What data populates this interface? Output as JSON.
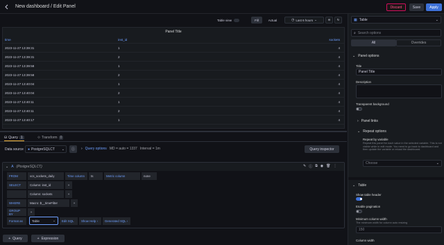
{
  "header": {
    "title": "New dashboard / Edit Panel",
    "discard": "Discard",
    "save": "Save",
    "apply": "Apply"
  },
  "toolbar": {
    "table_view": "Table view",
    "fill": "Fill",
    "actual": "Actual",
    "time_range": "Last 6 hours"
  },
  "panel": {
    "title": "Panel Title",
    "columns": [
      "time",
      "inst_id",
      "sockets"
    ],
    "rows": [
      [
        "2023-11-27 13:39:31",
        "1",
        "4"
      ],
      [
        "2023-11-27 13:39:31",
        "2",
        "4"
      ],
      [
        "2023-11-27 13:39:58",
        "1",
        "4"
      ],
      [
        "2023-11-27 13:39:58",
        "2",
        "4"
      ],
      [
        "2023-11-27 13:40:04",
        "1",
        "4"
      ],
      [
        "2023-11-27 13:40:04",
        "2",
        "4"
      ],
      [
        "2023-11-27 13:40:11",
        "1",
        "4"
      ],
      [
        "2023-11-27 13:40:11",
        "2",
        "4"
      ],
      [
        "2023-11-27 13:40:17",
        "1",
        "4"
      ]
    ]
  },
  "tabs": {
    "query": "Query",
    "query_count": "1",
    "transform": "Transform",
    "transform_count": "0"
  },
  "datasource": {
    "label": "Data source",
    "name": "PostgreSQLCT",
    "query_options": "Query options",
    "md": "MD = auto = 1337",
    "interval": "Interval = 1m",
    "inspector": "Query inspector"
  },
  "query": {
    "letter": "A",
    "source": "(PostgreSQLCT)",
    "from_label": "FROM",
    "from_table": "vcs_sockets_daily",
    "time_col_label": "Time column",
    "time_col": "ts",
    "metric_col_label": "Metric column",
    "metric_col": "none",
    "select_label": "SELECT",
    "select_1": "Column: inst_id",
    "select_2": "Column: sockets",
    "where_label": "WHERE",
    "where_1": "Macro: $__timeFilter",
    "groupby_label": "GROUP BY",
    "format_label": "Format as",
    "format_value": "Table",
    "edit_sql": "Edit SQL",
    "show_help": "Show Help ›",
    "generated_sql": "Generated SQL ›"
  },
  "bottom": {
    "add_query": "Query",
    "add_expression": "Expression"
  },
  "sidebar": {
    "viz": "Table",
    "search_placeholder": "Search options",
    "tab_all": "All",
    "tab_overrides": "Overrides",
    "panel_options": "Panel options",
    "title_label": "Title",
    "title_value": "Panel Title",
    "desc_label": "Description",
    "transparent_label": "Transparent background",
    "panel_links": "Panel links",
    "repeat_options": "Repeat options",
    "repeat_by_label": "Repeat by variable",
    "repeat_help": "Repeat this panel for each value in the selected variable. This is not visible while in edit mode. You need to go back to dashboard and then update the variable or reload the dashboard.",
    "choose": "Choose",
    "table_section": "Table",
    "show_header": "Show table header",
    "enable_pagination": "Enable pagination",
    "min_col_width": "Minimum column width",
    "min_col_help": "The minimum width for column auto resizing",
    "min_col_value": "150",
    "col_width": "Column width"
  }
}
